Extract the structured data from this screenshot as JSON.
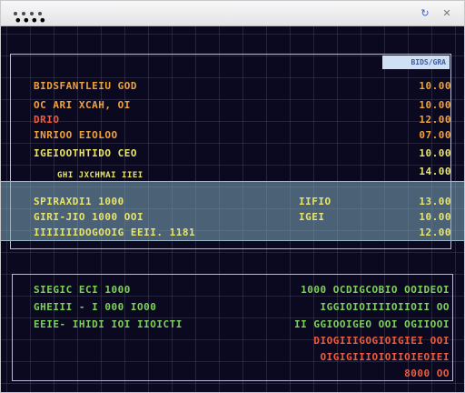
{
  "window": {
    "title_dots": [
      "•",
      "•",
      "•",
      "•"
    ],
    "icons": [
      "refresh-icon",
      "close-icon"
    ],
    "refresh_glyph": "↻",
    "close_glyph": "✕"
  },
  "panel": {
    "badge_label": "BIDS/GRA",
    "top_rows": [
      {
        "label": "BIDSFANTLEIU GOD",
        "value": "10.00"
      },
      {
        "label": "OC ARI XCAH, OI",
        "value": "10.00"
      },
      {
        "label": "DRIO",
        "value": "12.00"
      },
      {
        "label": "INRIOO EIOLOO",
        "value": "07.00"
      },
      {
        "label": "IGEIOOTHTIDO CEO",
        "value": "10.00"
      },
      {
        "label": "GHI JXCHMAI IIEI",
        "value": "14.00"
      }
    ],
    "selected_rows": [
      {
        "label": "SPIRAXDI1 1000",
        "mid": "IIFIO",
        "value": "13.00"
      },
      {
        "label": "GIRI-JIO 1000 OOI",
        "mid": "IGEI",
        "value": "10.00"
      },
      {
        "label": "IIIIIIIDOGOOIG EEII. 1181",
        "mid": "",
        "value": "12.00"
      }
    ],
    "bottom_rows": [
      {
        "label": "SIEGIC ECI 1000",
        "value": "1000 OCDIGCOBIO OOIDEOI",
        "color": "green"
      },
      {
        "label": "GHEIII - I 000 IO00",
        "value": "IGGIOIOIIIIOIIOII OO",
        "color": "green"
      },
      {
        "label": "EEIE- IHIDI IOI IIOICTI",
        "value": "II GGIOOIGEO OOI OGIIOOI",
        "color": "green"
      },
      {
        "label": "",
        "value": "DIOGIIIGOGIOIGIEI OOI",
        "color": "red"
      },
      {
        "label": "",
        "value": "OIGIGIIIOIOIIOIEOIEI",
        "color": "red"
      },
      {
        "label": "",
        "value": "8000 OO",
        "color": "red"
      }
    ]
  }
}
